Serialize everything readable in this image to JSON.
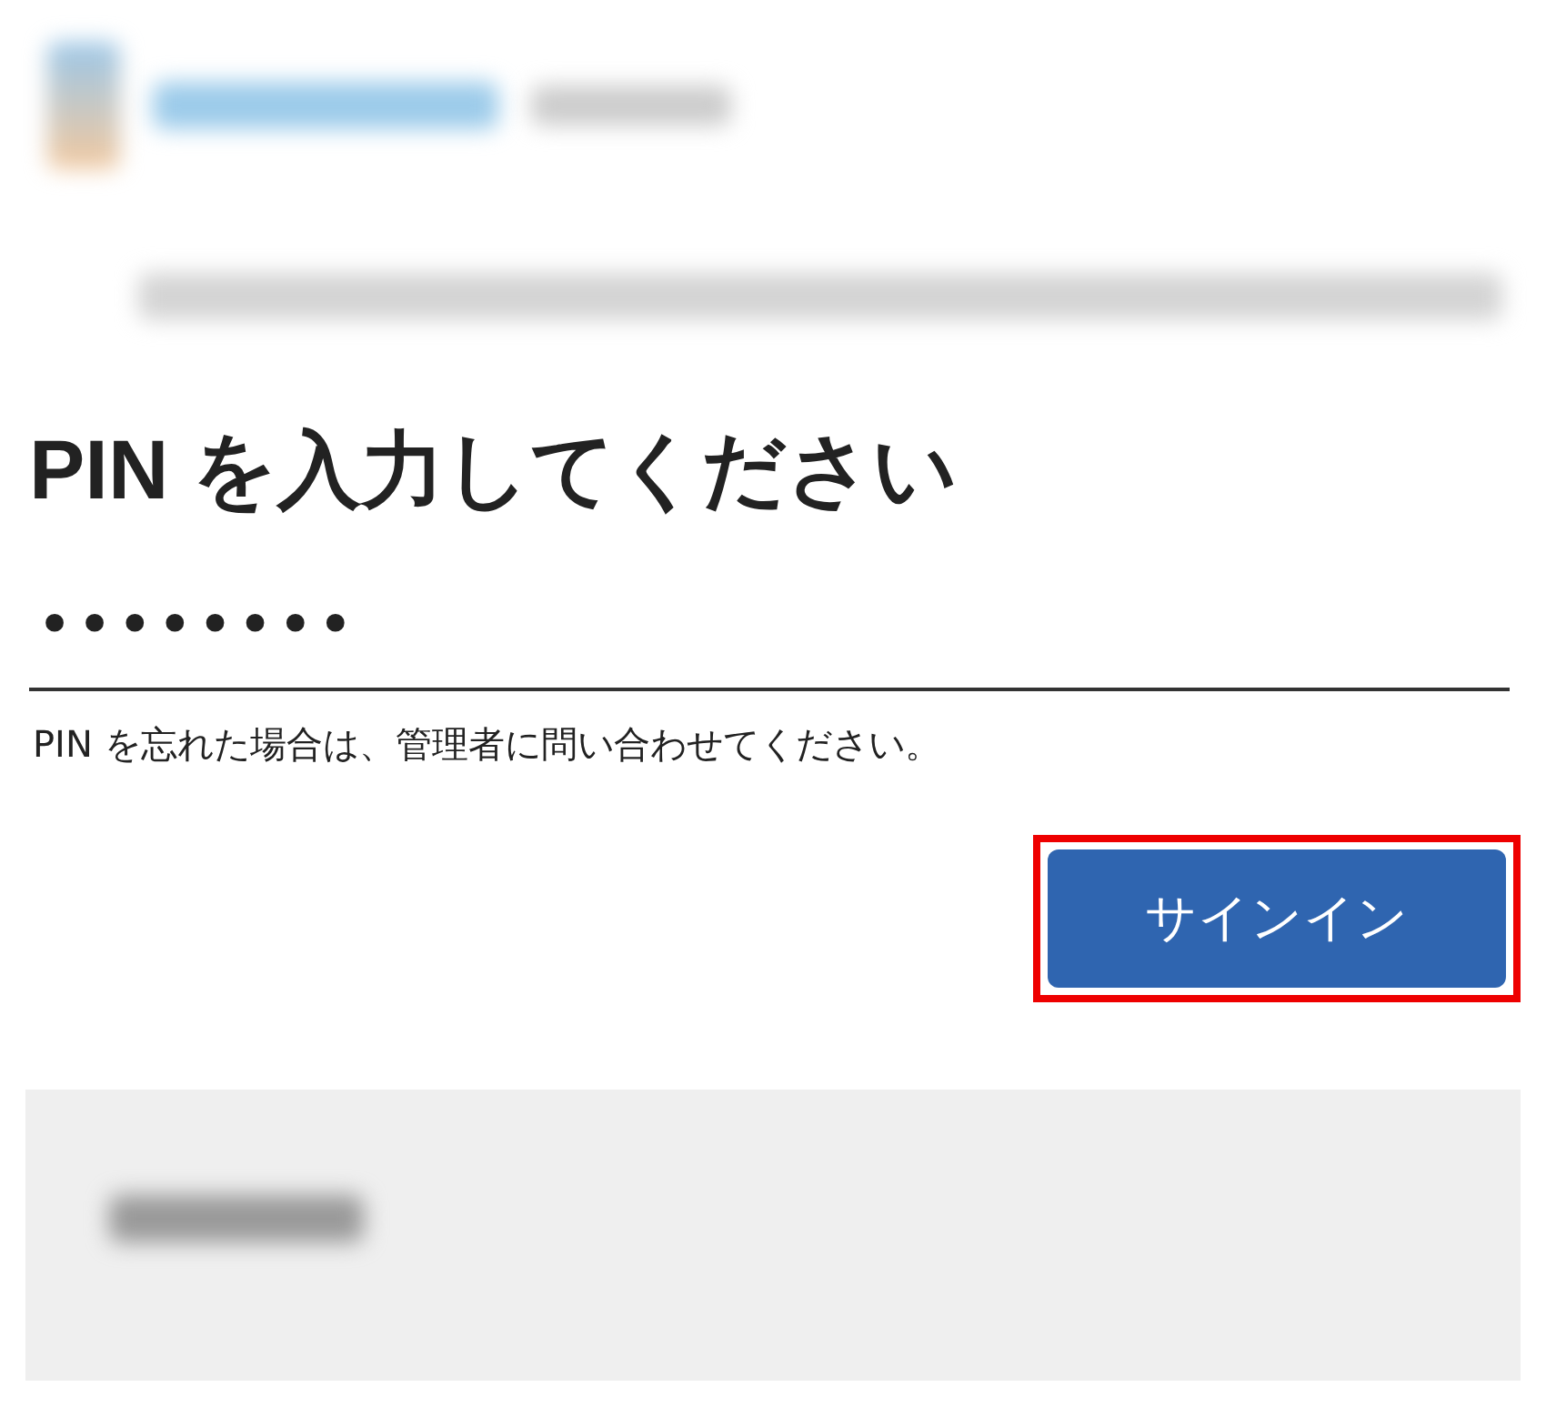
{
  "heading": "PIN を入力してください",
  "pin_field": {
    "value": "••••••••"
  },
  "helper_text": "PIN を忘れた場合は、管理者に問い合わせてください。",
  "sign_in_button": {
    "label": "サインイン",
    "highlighted": true
  }
}
